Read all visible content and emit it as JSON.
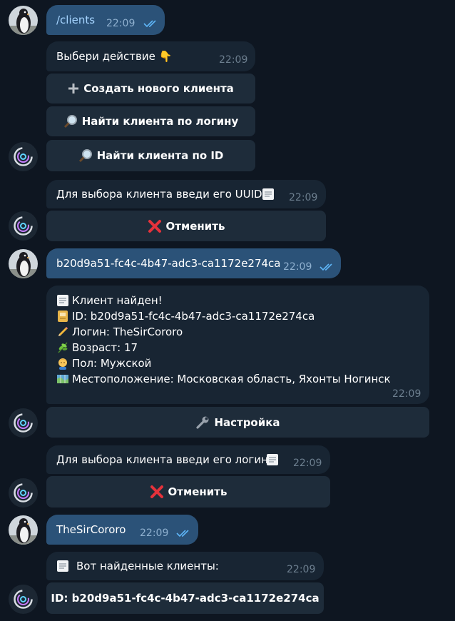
{
  "messages": {
    "cmd_clients": {
      "text": "/clients",
      "time": "22:09"
    },
    "choose_action": {
      "text": "Выбери действие 👇",
      "time": "22:09",
      "buttons": {
        "create": "Создать нового клиента",
        "find_login": "Найти клиента по логину",
        "find_id": "Найти клиента по ID"
      }
    },
    "enter_uuid": {
      "text": "Для выбора клиента введи его UUID",
      "time": "22:09",
      "cancel": "Отменить"
    },
    "user_uuid": {
      "text": "b20d9a51-fc4c-4b47-adc3-ca1172e274ca",
      "time": "22:09"
    },
    "client_found": {
      "title": "Клиент найден!",
      "id_line": "ID: b20d9a51-fc4c-4b47-adc3-ca1172e274ca",
      "login_line": "Логин: TheSirCororo",
      "age_line": "Возраст: 17",
      "gender_line": "Пол: Мужской",
      "location_line": "Местоположение: Московская область, Яхонты Ногинск",
      "time": "22:09",
      "settings_button": "Настройка"
    },
    "enter_login": {
      "text": "Для выбора клиента введи его логин",
      "time": "22:09",
      "cancel": "Отменить"
    },
    "user_login": {
      "text": "TheSirCororo",
      "time": "22:09"
    },
    "found_clients": {
      "text": "Вот найденные клиенты:",
      "time": "22:09",
      "result_button": "ID: b20d9a51-fc4c-4b47-adc3-ca1172e274ca"
    }
  },
  "colors": {
    "background": "#0e1621",
    "outgoing_bubble": "#2b5278",
    "incoming_bubble": "#182533",
    "keyboard_button": "#1e2c3a",
    "read_checks": "#5eb5f7"
  },
  "icons": {
    "user_avatar": "penguin-avatar",
    "bot_avatar": "bot-logo-avatar",
    "read_status": "double-check-icon",
    "create": "plus-icon",
    "search": "magnifier-icon",
    "cancel": "red-cross-icon",
    "notepad": "notepad-icon",
    "settings": "wrench-icon"
  }
}
